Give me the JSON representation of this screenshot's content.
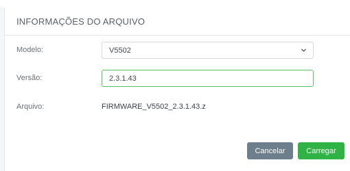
{
  "panel": {
    "title": "INFORMAÇÕES DO ARQUIVO"
  },
  "form": {
    "model_label": "Modelo:",
    "model_value": "V5502",
    "version_label": "Versão:",
    "version_value": "2.3.1.43",
    "file_label": "Arquivo:",
    "file_value": "FIRMWARE_V5502_2.3.1.43.z"
  },
  "actions": {
    "cancel_label": "Cancelar",
    "load_label": "Carregar"
  },
  "colors": {
    "load_button": "#2fb344",
    "cancel_button": "#6d7f8c",
    "active_input_border": "#5bbf63"
  },
  "icons": {
    "model_select": "chevron-down-icon"
  }
}
